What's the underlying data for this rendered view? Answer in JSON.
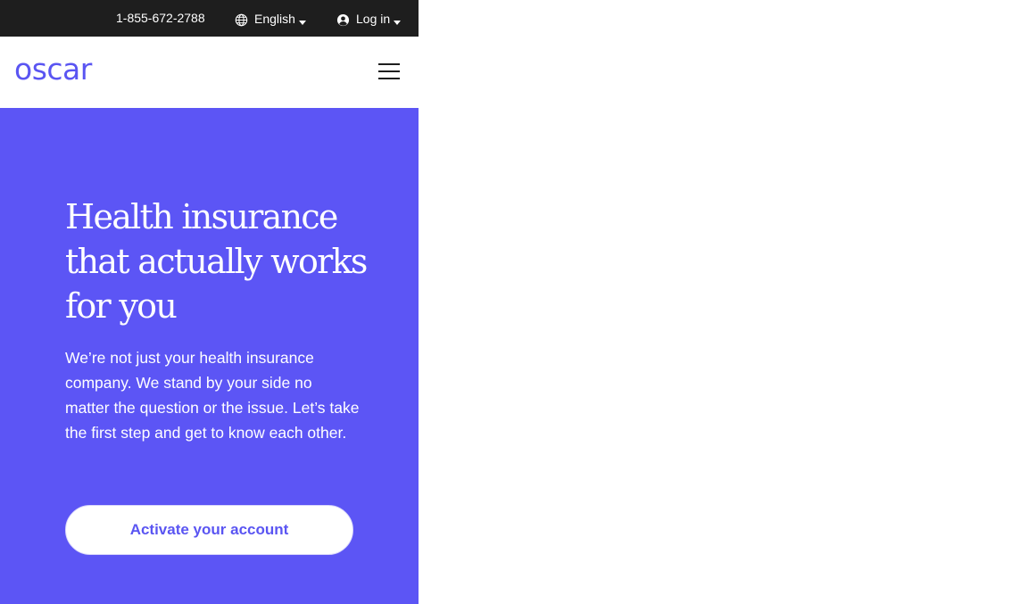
{
  "colors": {
    "brand": "#5a55f2",
    "hero_background": "#5c55f5",
    "topbar_background": "#1e1e1e",
    "text_on_brand": "#ffffff"
  },
  "topbar": {
    "phone": "1-855-672-2788",
    "language": {
      "label": "English",
      "icon": "globe-icon"
    },
    "login": {
      "label": "Log in",
      "icon": "user-circle-icon"
    }
  },
  "header": {
    "logo": "oscar",
    "menu_icon": "hamburger-menu-icon"
  },
  "hero": {
    "title": "Health insurance that actually works for you",
    "body": "We’re not just your health insurance company. We stand by your side no matter the question or the issue. Let’s take the first step and get to know each other.",
    "cta": "Activate your account"
  }
}
